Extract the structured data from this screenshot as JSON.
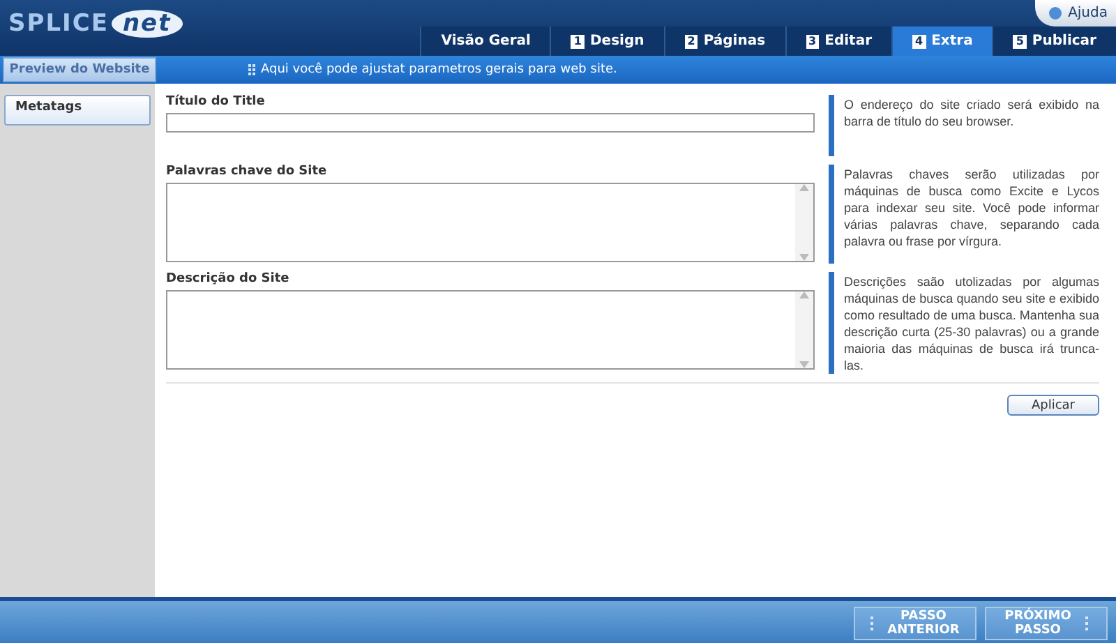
{
  "logo": {
    "first": "SPLICE",
    "second": "net"
  },
  "help_link": "Ajuda",
  "tabs": [
    {
      "label": "Visão Geral",
      "selected": false
    },
    {
      "number": "1",
      "label": "Design",
      "selected": false
    },
    {
      "number": "2",
      "label": "Páginas",
      "selected": false
    },
    {
      "number": "3",
      "label": "Editar",
      "selected": false
    },
    {
      "number": "4",
      "label": "Extra",
      "selected": true
    },
    {
      "number": "5",
      "label": "Publicar",
      "selected": false
    }
  ],
  "preview_button": "Preview do Website",
  "hint": "Aqui você pode ajustat parametros gerais para web site.",
  "sidebar": {
    "items": [
      {
        "label": "Metatags",
        "selected": true
      }
    ]
  },
  "fields": [
    {
      "kind": "input",
      "label": "Título do Title",
      "help": "O endereço do site criado será exibido na barra de título do seu browser."
    },
    {
      "kind": "textarea",
      "label": "Palavras chave do Site",
      "help": "Palavras chaves serão utilizadas por máquinas de busca como Excite e Lycos para indexar seu site. Você pode informar várias palavras chave, separando cada palavra ou frase por vírgura."
    },
    {
      "kind": "textarea",
      "label": "Descrição do Site",
      "help": "Descrições saão utolizadas por algumas máquinas de busca quando seu site e exibido como resultado de uma busca. Mantenha sua descrição curta (25-30 palavras) ou a grande maioria das máquinas de busca irá trunca-las."
    }
  ],
  "apply_button": "Aplicar",
  "footer": {
    "previous": [
      "PASSO",
      "ANTERIOR"
    ],
    "next": [
      "PRÓXIMO",
      "PASSO"
    ]
  }
}
